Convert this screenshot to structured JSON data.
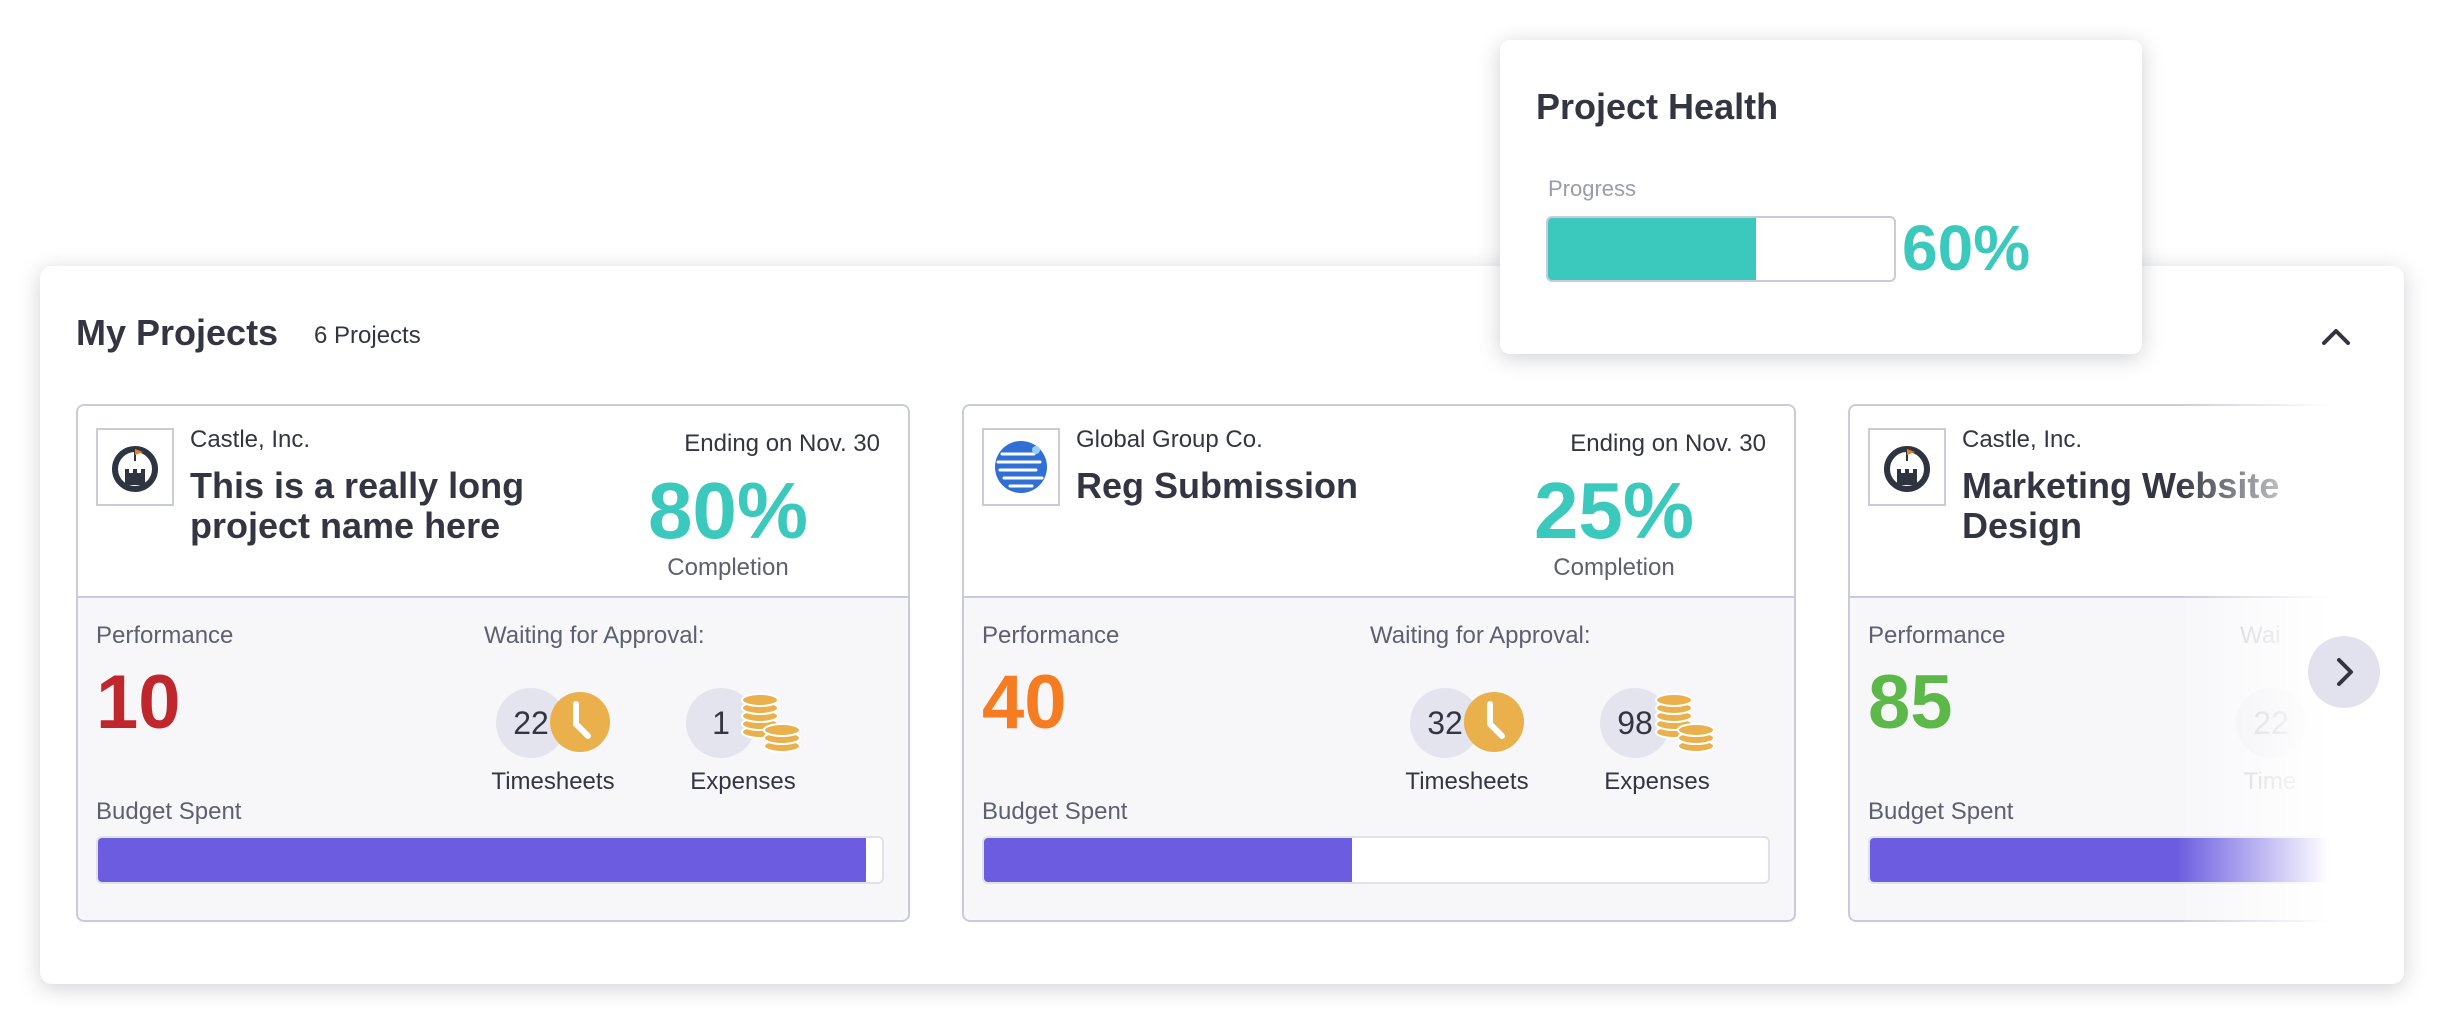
{
  "colors": {
    "teal": "#3cc9bd",
    "budget": "#6b5ce0",
    "red": "#c0272d",
    "orange": "#f57c20",
    "green": "#5cb848",
    "gold": "#e9b04c",
    "text": "#333642"
  },
  "popup": {
    "title": "Project Health",
    "progress_label": "Progress",
    "progress_pct": "60%",
    "progress_value": 0.6
  },
  "panel": {
    "title": "My Projects",
    "count": "6 Projects",
    "collapse_icon": "chevron-up-icon",
    "next_icon": "chevron-right-icon"
  },
  "projects": [
    {
      "logo": "castle-logo-icon",
      "client": "Castle, Inc.",
      "name": "This is a really long project name here",
      "ending": "Ending on Nov. 30",
      "completion_pct": "80%",
      "completion_label": "Completion",
      "performance_label": "Performance",
      "performance": "10",
      "waiting_label": "Waiting for Approval:",
      "timesheets": "22",
      "timesheets_label": "Timesheets",
      "expenses": "1",
      "expenses_label": "Expenses",
      "budget_label": "Budget Spent",
      "budget_value": 0.98
    },
    {
      "logo": "globe-logo-icon",
      "client": "Global Group Co.",
      "name": "Reg Submission",
      "ending": "Ending on Nov. 30",
      "completion_pct": "25%",
      "completion_label": "Completion",
      "performance_label": "Performance",
      "performance": "40",
      "waiting_label": "Waiting for Approval:",
      "timesheets": "32",
      "timesheets_label": "Timesheets",
      "expenses": "98",
      "expenses_label": "Expenses",
      "budget_label": "Budget Spent",
      "budget_value": 0.47
    },
    {
      "logo": "castle-logo-icon",
      "client": "Castle, Inc.",
      "name": "Marketing Website Design",
      "performance_label": "Performance",
      "performance": "85",
      "waiting_label": "Wai",
      "timesheets": "22",
      "timesheets_label": "Time",
      "budget_label": "Budget Spent",
      "budget_value": 0.9
    }
  ]
}
